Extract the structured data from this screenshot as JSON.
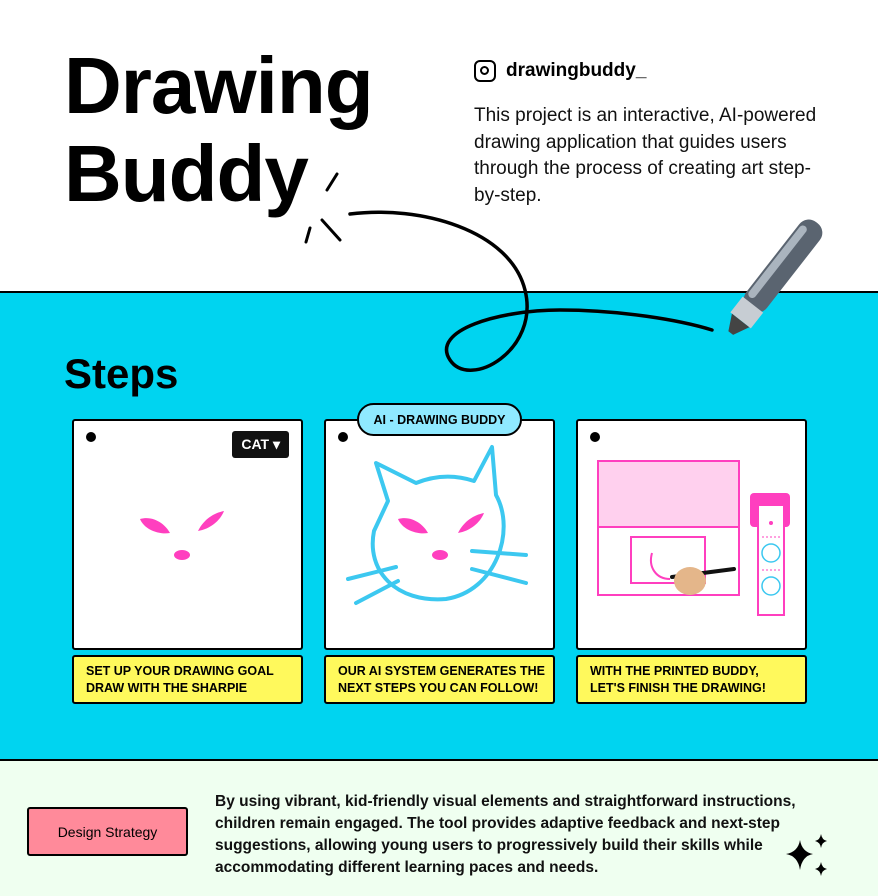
{
  "header": {
    "title_line1": "Drawing",
    "title_line2": "Buddy",
    "instagram_icon": "instagram-icon",
    "handle": "drawingbuddy_",
    "description": "This project is an interactive, AI-powered drawing application that guides users through the process of creating art step-by-step."
  },
  "steps": {
    "heading": "Steps",
    "cards": [
      {
        "selector": "CAT ▾",
        "caption_line1": "SET UP YOUR DRAWING GOAL",
        "caption_line2": "DRAW WITH THE SHARPIE"
      },
      {
        "badge": "AI - DRAWING BUDDY",
        "caption_line1": "OUR AI SYSTEM GENERATES THE",
        "caption_line2": "NEXT STEPS YOU CAN FOLLOW!"
      },
      {
        "caption_line1": "WITH THE PRINTED BUDDY,",
        "caption_line2": "LET'S FINISH THE DRAWING!"
      }
    ]
  },
  "footer": {
    "button": "Design Strategy",
    "text": "By using vibrant, kid-friendly visual elements and straightforward instructions, children remain engaged. The tool provides adaptive feedback and next-step suggestions, allowing young users to progressively build their skills while accommodating different learning paces and needs."
  },
  "colors": {
    "cyan": "#00d4f0",
    "yellow": "#fff95c",
    "pink": "#ff3fbf",
    "light_pink": "#ffd0ee",
    "blue_line": "#3cc8f0",
    "button": "#ff8a9a",
    "footer_bg": "#effff0"
  }
}
